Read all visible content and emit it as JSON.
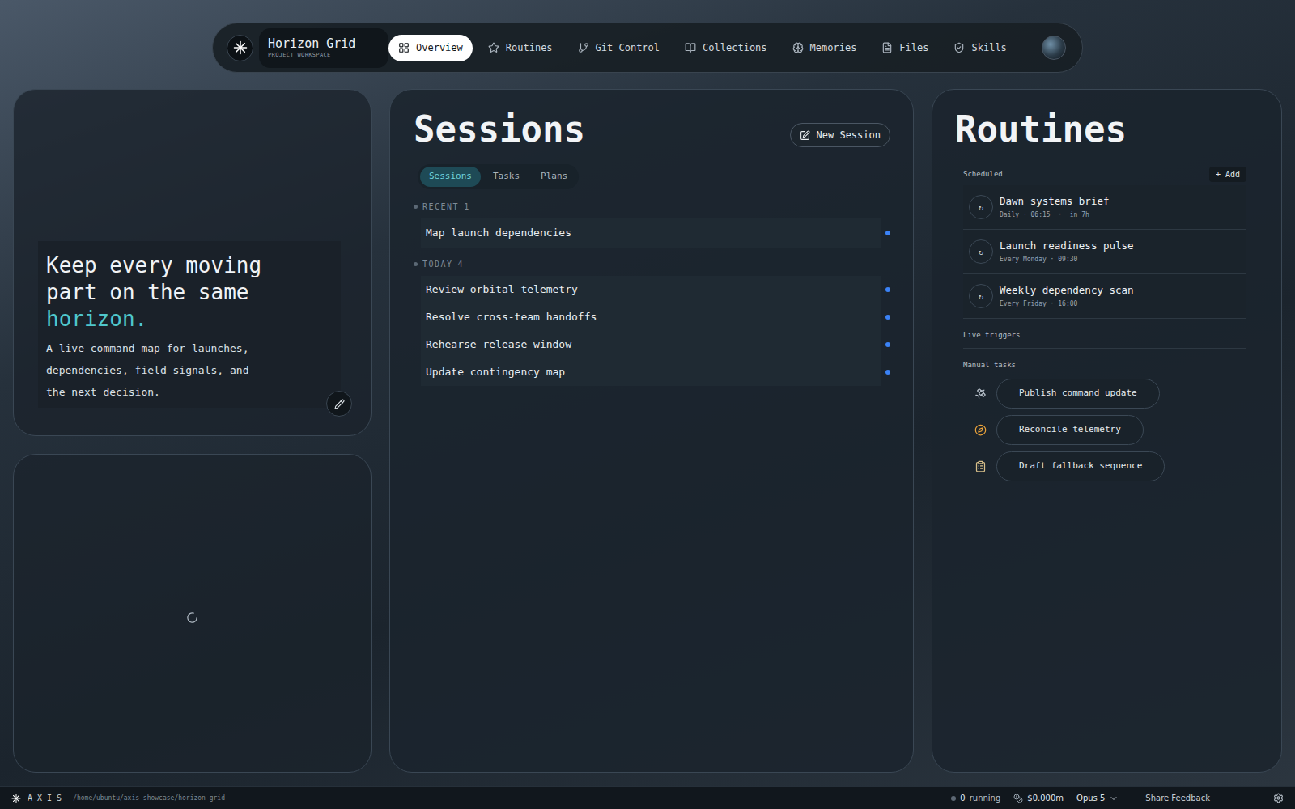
{
  "nav": {
    "title": "Horizon Grid",
    "subtitle": "PROJECT WORKSPACE",
    "tabs": [
      {
        "label": "Overview",
        "selected": true
      },
      {
        "label": "Routines",
        "selected": false
      },
      {
        "label": "Git Control",
        "selected": false
      },
      {
        "label": "Collections",
        "selected": false
      },
      {
        "label": "Memories",
        "selected": false
      },
      {
        "label": "Files",
        "selected": false
      },
      {
        "label": "Skills",
        "selected": false
      }
    ]
  },
  "hero": {
    "headline": "Keep every moving part on the same",
    "accent": "horizon.",
    "body": "A live command map for launches, dependencies, field signals, and the next decision."
  },
  "media_panel": {
    "loading": true
  },
  "sessions": {
    "title": "Sessions",
    "new_button": "New Session",
    "tabs": [
      {
        "label": "Sessions",
        "selected": true
      },
      {
        "label": "Tasks",
        "selected": false
      },
      {
        "label": "Plans",
        "selected": false
      }
    ],
    "groups": [
      {
        "label": "RECENT",
        "count": "1",
        "items": [
          {
            "title": "Map launch dependencies"
          }
        ]
      },
      {
        "label": "TODAY",
        "count": "4",
        "items": [
          {
            "title": "Review orbital telemetry"
          },
          {
            "title": "Resolve cross-team handoffs"
          },
          {
            "title": "Rehearse release window"
          },
          {
            "title": "Update contingency map"
          }
        ]
      }
    ]
  },
  "routines": {
    "title": "Routines",
    "scheduled_label": "Scheduled",
    "add_button": "+ Add",
    "scheduled": [
      {
        "icon": "↻",
        "name": "Dawn systems brief",
        "schedule": "Daily · 06:15  ·  in 7h"
      },
      {
        "icon": "↻",
        "name": "Launch readiness pulse",
        "schedule": "Every Monday · 09:30"
      },
      {
        "icon": "↻",
        "name": "Weekly dependency scan",
        "schedule": "Every Friday · 16:00"
      }
    ],
    "live_triggers_label": "Live triggers",
    "manual_label": "Manual tasks",
    "manual": [
      {
        "label": "Publish command update"
      },
      {
        "label": "Reconcile telemetry"
      },
      {
        "label": "Draft fallback sequence"
      }
    ]
  },
  "status_bar": {
    "brand": "A X I S",
    "path": "/home/ubuntu/axis-showcase/horizon-grid",
    "running_count": "0",
    "running_label": "running",
    "cost": "$0.000m",
    "model": "Opus 5",
    "feedback": "Share Feedback"
  }
}
